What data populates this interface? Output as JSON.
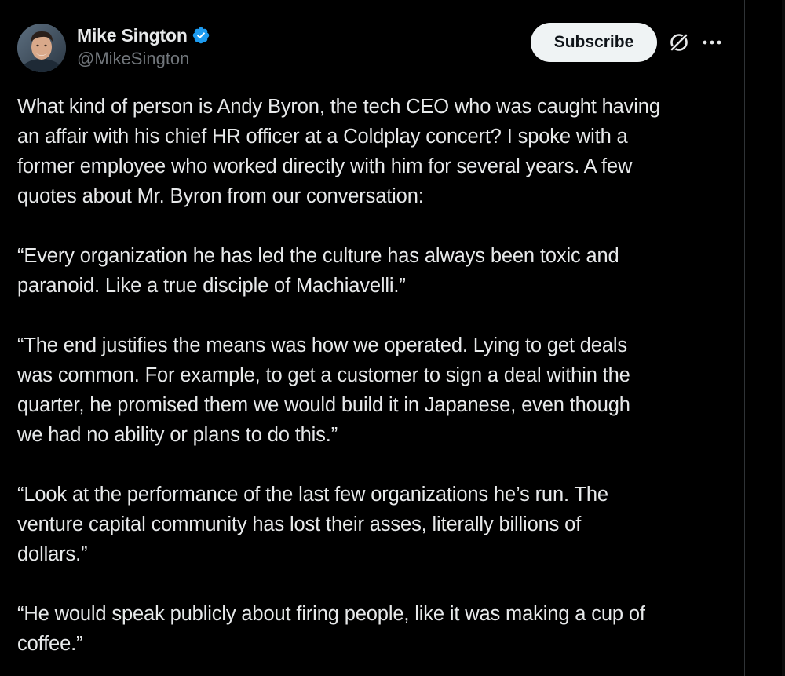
{
  "tweet": {
    "author": {
      "display_name": "Mike Sington",
      "handle": "@MikeSington",
      "verified": true,
      "avatar_icon": "avatar-photo"
    },
    "actions": {
      "subscribe_label": "Subscribe",
      "grok_icon": "grok-icon",
      "more_icon": "more-icon"
    },
    "paragraphs": [
      {
        "lines": [
          "What kind of person is Andy Byron, the tech CEO who was caught having",
          "an affair with his chief HR officer at a Coldplay concert? I spoke with a",
          "former employee who worked directly with him for several years. A few",
          "quotes about Mr. Byron from our conversation:"
        ]
      },
      {
        "lines": [
          "“Every organization he has led the culture has always been toxic and",
          "paranoid. Like a true disciple of Machiavelli.”"
        ]
      },
      {
        "lines": [
          "“The end justifies the means was how we operated. Lying to get deals",
          "was common. For example, to get a customer to sign a deal within the",
          "quarter, he promised them we would build it in Japanese, even though",
          "we had no ability or plans to do this.”"
        ]
      },
      {
        "lines": [
          "“Look at the performance of the last few organizations he’s run. The",
          "venture capital community has lost their asses, literally billions of",
          "dollars.”"
        ]
      },
      {
        "lines": [
          "“He would speak publicly about firing people, like it was making a cup of",
          "coffee.”"
        ]
      }
    ]
  },
  "colors": {
    "background": "#000000",
    "text_primary": "#e7e9ea",
    "text_secondary": "#71767b",
    "verified_blue": "#1d9bf0",
    "button_bg": "#eff3f4",
    "button_text": "#0f1419",
    "divider": "#2f3336"
  }
}
